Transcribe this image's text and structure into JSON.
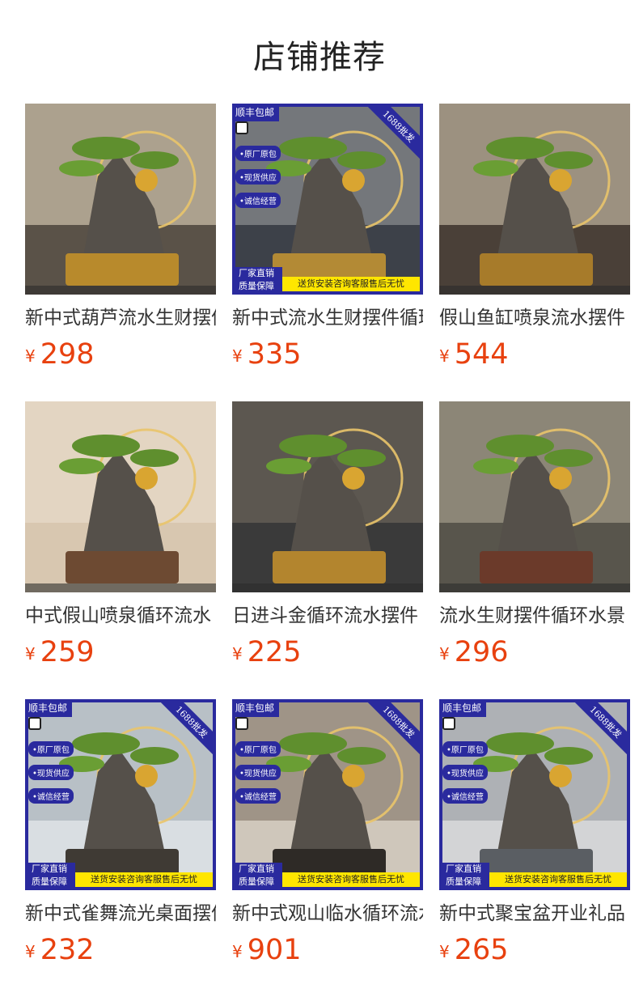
{
  "page": {
    "title": "店铺推荐"
  },
  "promo": {
    "top_left": "顺丰包邮",
    "corner": "1688批发",
    "tags": [
      "•原厂原包",
      "•现货供应",
      "•诚信经营"
    ],
    "bottom_left_line1": "厂家直销",
    "bottom_left_line2": "质量保障",
    "bottom_banner": "送货安装咨询客服售后无忧"
  },
  "currency": "¥",
  "products": [
    {
      "name": "新中式葫芦流水生财摆件",
      "price": "298",
      "promo": false,
      "bg": "#5a5248",
      "scene": "#cfc3ad",
      "base": "#b88a2c"
    },
    {
      "name": "新中式流水生财摆件循环",
      "price": "335",
      "promo": true,
      "bg": "#3d4149",
      "scene": "#8c8f92",
      "base": "#b38a35"
    },
    {
      "name": "假山鱼缸喷泉流水摆件",
      "price": "544",
      "promo": false,
      "bg": "#4a4038",
      "scene": "#bfb4a0",
      "base": "#a77b2a"
    },
    {
      "name": "中式假山喷泉循环流水",
      "price": "259",
      "promo": false,
      "bg": "#d8c7b0",
      "scene": "#e8dccb",
      "base": "#6d4a32"
    },
    {
      "name": "日进斗金循环流水摆件",
      "price": "225",
      "promo": false,
      "bg": "#3a3a3a",
      "scene": "#6b645a",
      "base": "#b3852e"
    },
    {
      "name": "流水生财摆件循环水景",
      "price": "296",
      "promo": false,
      "bg": "#58554c",
      "scene": "#a39b8a",
      "base": "#6b3a2a"
    },
    {
      "name": "新中式雀舞流光桌面摆件",
      "price": "232",
      "promo": true,
      "bg": "#d9dee2",
      "scene": "#aab3bb",
      "base": "#3f3a34"
    },
    {
      "name": "新中式观山临水循环流水",
      "price": "901",
      "promo": true,
      "bg": "#cfc7bb",
      "scene": "#8a7f70",
      "base": "#2e2a26"
    },
    {
      "name": "新中式聚宝盆开业礼品",
      "price": "265",
      "promo": true,
      "bg": "#d3d4d6",
      "scene": "#9ea2a6",
      "base": "#5a5e63"
    }
  ]
}
